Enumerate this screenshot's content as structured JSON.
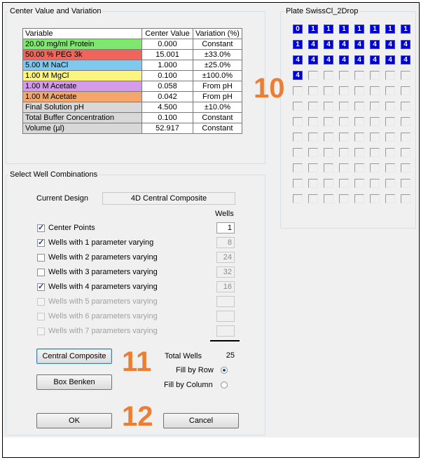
{
  "center_group": {
    "title": "Center Value and Variation",
    "headers": [
      "Variable",
      "Center Value",
      "Variation (%)"
    ],
    "rows": [
      {
        "variable": "20.00 mg/ml Protein",
        "center": "0.000",
        "variation": "Constant",
        "color": "#7fe66e"
      },
      {
        "variable": "50.00 % PEG 3k",
        "center": "15.001",
        "variation": "±33.0%",
        "color": "#f0655a"
      },
      {
        "variable": "5.00 M NaCl",
        "center": "1.000",
        "variation": "±25.0%",
        "color": "#7fc8ee"
      },
      {
        "variable": "1.00 M MgCl",
        "center": "0.100",
        "variation": "±100.0%",
        "color": "#fbf57f"
      },
      {
        "variable": "1.00 M Acetate",
        "center": "0.058",
        "variation": "From pH",
        "color": "#d49be8"
      },
      {
        "variable": "1.00 M Acetate",
        "center": "0.042",
        "variation": "From pH",
        "color": "#f6a66a"
      },
      {
        "variable": "Final Solution pH",
        "center": "4.500",
        "variation": "±10.0%",
        "color": "#d8d8d8"
      },
      {
        "variable": "Total Buffer Concentration",
        "center": "0.100",
        "variation": "Constant",
        "color": "#d8d8d8"
      },
      {
        "variable": "Volume (µl)",
        "center": "52.917",
        "variation": "Constant",
        "color": "#d8d8d8"
      }
    ]
  },
  "plate_group": {
    "title": "Plate SwissCl_2Drop",
    "filled_wells": [
      [
        "0",
        "1",
        "1",
        "1",
        "1",
        "1",
        "1",
        "1"
      ],
      [
        "1",
        "4",
        "4",
        "4",
        "4",
        "4",
        "4",
        "4"
      ],
      [
        "4",
        "4",
        "4",
        "4",
        "4",
        "4",
        "4",
        "4"
      ],
      [
        "4"
      ]
    ],
    "rows": 12,
    "cols": 8,
    "well_color": "#0000cc"
  },
  "wells_group": {
    "title": "Select Well Combinations",
    "current_design_label": "Current Design",
    "current_design_value": "4D Central Composite",
    "wells_header": "Wells",
    "options": [
      {
        "label": "Center Points",
        "checked": true,
        "enabled": true,
        "count": "1"
      },
      {
        "label": "Wells with 1 parameter varying",
        "checked": true,
        "enabled": true,
        "count": "8"
      },
      {
        "label": "Wells with 2 parameters varying",
        "checked": false,
        "enabled": true,
        "count": "24"
      },
      {
        "label": "Wells with 3 parameters varying",
        "checked": false,
        "enabled": true,
        "count": "32"
      },
      {
        "label": "Wells with 4 parameters varying",
        "checked": true,
        "enabled": true,
        "count": "16"
      },
      {
        "label": "Wells with 5 parameters varying",
        "checked": false,
        "enabled": false,
        "count": ""
      },
      {
        "label": "Wells with 6 parameters varying",
        "checked": false,
        "enabled": false,
        "count": ""
      },
      {
        "label": "Wells with 7 parameters varying",
        "checked": false,
        "enabled": false,
        "count": ""
      }
    ],
    "total_wells_label": "Total Wells",
    "total_wells_value": "25",
    "fill_by_row_label": "Fill by Row",
    "fill_by_column_label": "Fill by Column",
    "fill_mode": "row"
  },
  "buttons": {
    "central_composite": "Central Composite",
    "box_benken": "Box Benken",
    "ok": "OK",
    "cancel": "Cancel"
  },
  "callouts": {
    "plate": "10",
    "design": "11",
    "confirm": "12"
  },
  "callout_color": "#ed7d31"
}
